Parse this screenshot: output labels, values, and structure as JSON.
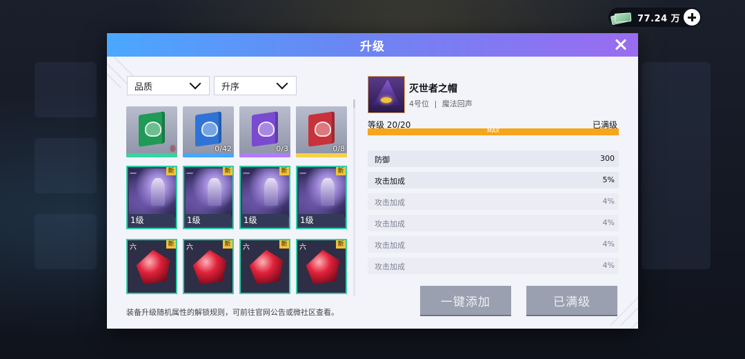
{
  "currency": {
    "value": "77.24 万",
    "icon": "cash-icon",
    "add_icon": "plus-icon"
  },
  "dialog": {
    "title": "升级",
    "close_icon": "close-icon",
    "filters": [
      {
        "label": "品质"
      },
      {
        "label": "升序"
      }
    ],
    "books": [
      {
        "count": "0",
        "color": "#1f9a57",
        "stripe": "#39d2a0"
      },
      {
        "count": "0/42",
        "color": "#2f73d6",
        "stripe": "#45a6ff"
      },
      {
        "count": "0/3",
        "color": "#7a4ad1",
        "stripe": "#b07cff"
      },
      {
        "count": "0/8",
        "color": "#c8323b",
        "stripe": "#f5d24a"
      }
    ],
    "cloaks": [
      {
        "tier": "一",
        "new": "新",
        "level": "1级"
      },
      {
        "tier": "一",
        "new": "新",
        "level": "1级"
      },
      {
        "tier": "一",
        "new": "新",
        "level": "1级"
      },
      {
        "tier": "一",
        "new": "新",
        "level": "1级"
      }
    ],
    "gems": [
      {
        "tier": "六",
        "new": "新"
      },
      {
        "tier": "六",
        "new": "新"
      },
      {
        "tier": "六",
        "new": "新"
      },
      {
        "tier": "六",
        "new": "新"
      }
    ],
    "hint": "装备升级随机属性的解锁规则，可前往官网公告或微社区查看。",
    "item": {
      "name": "灭世者之帽",
      "slot": "4号位",
      "separator": "|",
      "set": "魔法回声",
      "level_label": "等级 20/20",
      "level_status": "已满级",
      "progress": 1.0,
      "progress_text": "MAX"
    },
    "stats": [
      {
        "name": "防御",
        "value": "300",
        "locked": false
      },
      {
        "name": "攻击加成",
        "value": "5%",
        "locked": false
      },
      {
        "name": "攻击加成",
        "value": "4%",
        "locked": true
      },
      {
        "name": "攻击加成",
        "value": "4%",
        "locked": true
      },
      {
        "name": "攻击加成",
        "value": "4%",
        "locked": true
      },
      {
        "name": "攻击加成",
        "value": "4%",
        "locked": true
      }
    ],
    "buttons": {
      "auto_add": "一键添加",
      "maxed": "已满级"
    }
  }
}
